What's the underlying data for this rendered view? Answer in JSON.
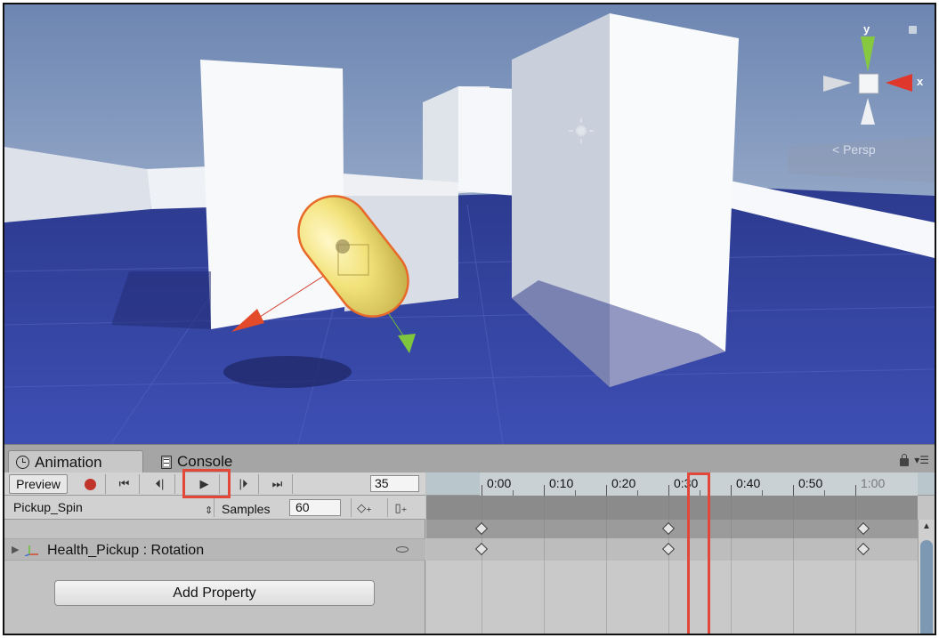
{
  "scene": {
    "gizmo": {
      "y_label": "y",
      "x_label": "x",
      "view_label": "Persp"
    }
  },
  "tabs": [
    {
      "label": "Animation",
      "icon": "clock-icon",
      "active": true
    },
    {
      "label": "Console",
      "icon": "console-doc-icon",
      "active": false
    }
  ],
  "toolbar": {
    "preview_label": "Preview",
    "frame_value": "35"
  },
  "clip": {
    "name": "Pickup_Spin",
    "samples_label": "Samples",
    "samples_value": "60"
  },
  "properties": [
    {
      "label": "Health_Pickup : Rotation"
    }
  ],
  "add_property_label": "Add Property",
  "timeline": {
    "ticks": [
      "0:00",
      "0:10",
      "0:20",
      "0:30",
      "0:40",
      "0:50",
      "1:00"
    ],
    "keyframes_at": [
      "0:00",
      "0:30",
      "1:00"
    ]
  },
  "colors": {
    "highlight": "#e2473a",
    "capsule": "#f2e27a",
    "floor": "#3a4aa8",
    "sky": "#7d93b8"
  }
}
